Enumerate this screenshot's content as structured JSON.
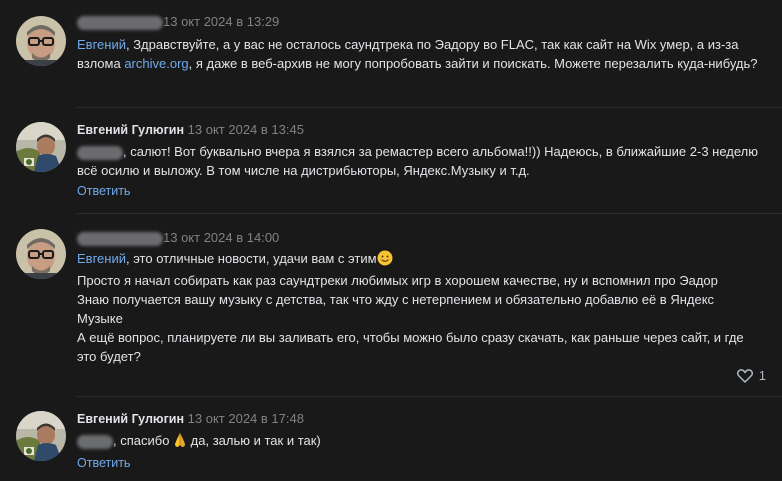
{
  "comments": [
    {
      "author": "",
      "date": "13 окт 2024 в 13:29",
      "mention": "Евгений",
      "lines": [
        ", Здравствуйте, а у вас не осталось саундтрека по Эадору во FLAC, так как сайт на Wix умер, а из-за",
        "взлома ",
        "archive.org",
        ", я даже в веб-архив не могу попробовать зайти и поискать. Можете перезалить куда-нибудь?"
      ],
      "avatar_icon": "avatar-glasses-man"
    },
    {
      "author": "Евгений Гулюгин",
      "date": "13 окт 2024 в 13:45",
      "lines": [
        ", салют! Вот буквально вчера я взялся за ремастер всего альбома!!)) Надеюсь, в ближайшие 2-3 неделю",
        "всё осилю и выложу. В том числе на дистрибьюторы, Яндекс.Музыку и т.д."
      ],
      "reply_label": "Ответить",
      "avatar_icon": "avatar-outdoor-man"
    },
    {
      "author": "",
      "date": "13 окт 2024 в 14:00",
      "mention": "Евгений",
      "lines": [
        ", это отличные новости, удачи вам с этим",
        "Просто я начал собирать как раз саундтреки любимых игр в хорошем качестве, ну и вспомнил про Эадор",
        "Знаю получается вашу музыку с детства, так что жду с нетерпением и обязательно добавлю её в Яндекс",
        "Музыке",
        "А ещё вопрос, планируете ли вы заливать его, чтобы можно было сразу скачать, как раньше через сайт, и где",
        "это будет?"
      ],
      "like_count": "1",
      "emoji": "smiling-face-emoji",
      "avatar_icon": "avatar-glasses-man"
    },
    {
      "author": "Евгений Гулюгин",
      "date": "13 окт 2024 в 17:48",
      "lines": [
        ", спасибо",
        " да, залью и так и так)"
      ],
      "reply_label": "Ответить",
      "emoji": "folded-hands-emoji",
      "avatar_icon": "avatar-outdoor-man"
    }
  ],
  "colors": {
    "background": "#19191a",
    "text": "#e1e3e6",
    "secondary": "#828282",
    "accent": "#71aaeb",
    "divider": "#2c2d2e"
  }
}
